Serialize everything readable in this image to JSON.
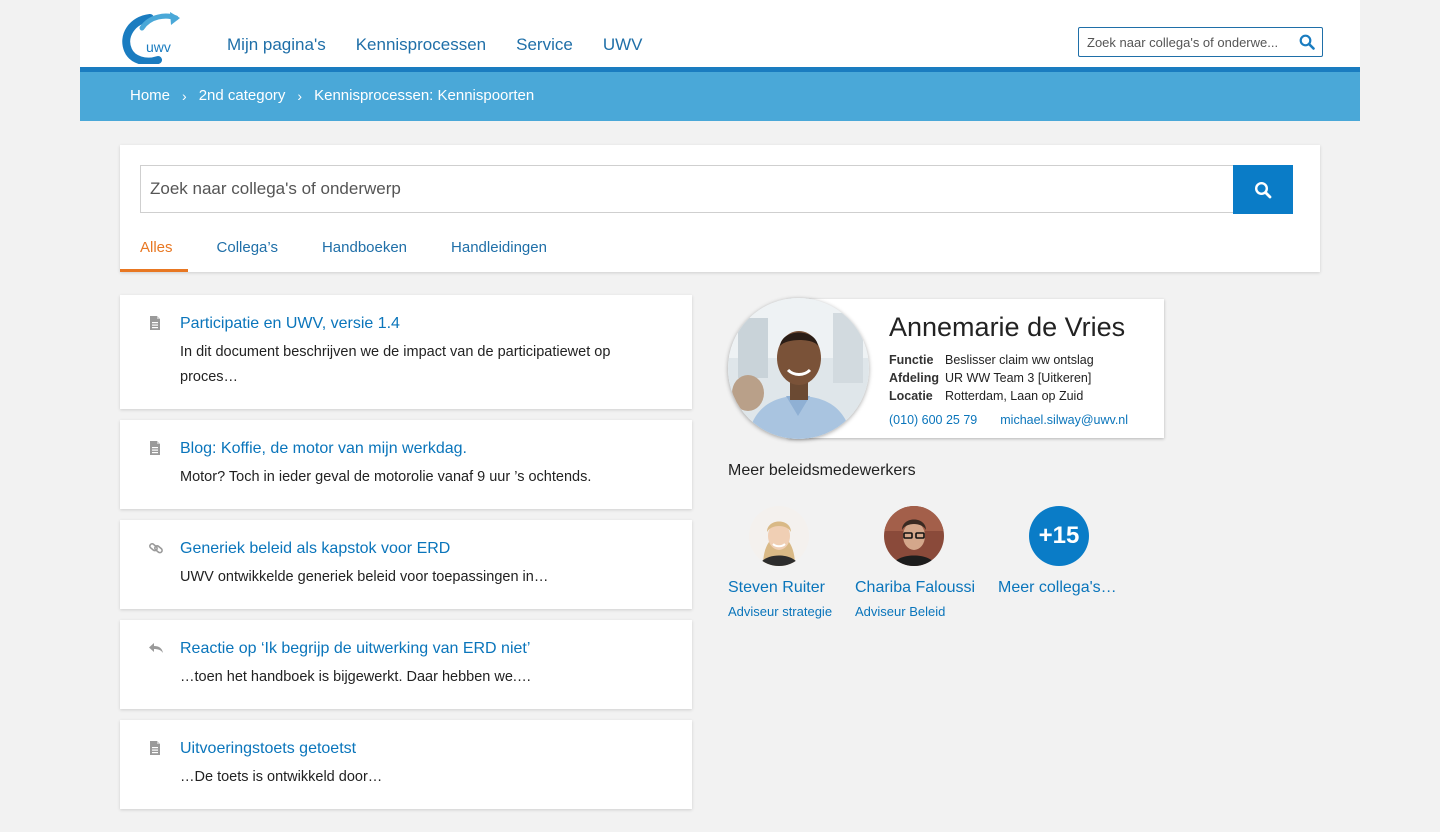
{
  "header": {
    "logo_text": "uwv",
    "nav": [
      "Mijn pagina's",
      "Kennisprocessen",
      "Service",
      "UWV"
    ],
    "search_placeholder": "Zoek naar collega's of onderwe..."
  },
  "breadcrumb": [
    "Home",
    "2nd category",
    "Kennisprocessen: Kennispoorten"
  ],
  "breadcrumb_separator": "›",
  "search": {
    "placeholder": "Zoek naar collega's of onderwerp",
    "tabs": [
      {
        "label": "Alles",
        "active": true
      },
      {
        "label": "Collega’s",
        "active": false
      },
      {
        "label": "Handboeken",
        "active": false
      },
      {
        "label": "Handleidingen",
        "active": false
      }
    ]
  },
  "results": [
    {
      "icon": "document-icon",
      "title": "Participatie en UWV, versie 1.4",
      "text": "In dit document beschrijven we de impact van de participatiewet op proces…"
    },
    {
      "icon": "document-icon",
      "title": "Blog: Koffie, de motor van mijn werkdag.",
      "text": "Motor? Toch in ieder geval de motorolie vanaf 9 uur ’s ochtends."
    },
    {
      "icon": "link-icon",
      "title": "Generiek beleid als kapstok voor ERD",
      "text": "UWV ontwikkelde generiek beleid voor toepassingen in…"
    },
    {
      "icon": "reply-icon",
      "title": "Reactie op ‘Ik begrijp de uitwerking van ERD niet’",
      "text": "…toen het handboek is bijgewerkt. Daar hebben we.…"
    },
    {
      "icon": "document-icon",
      "title": "Uitvoeringstoets getoetst",
      "text": "…De toets is ontwikkeld door…"
    }
  ],
  "profile": {
    "name": "Annemarie de Vries",
    "fields": [
      {
        "label": "Functie",
        "value": "Beslisser claim ww ontslag"
      },
      {
        "label": "Afdeling",
        "value": "UR WW Team 3 [Uitkeren]"
      },
      {
        "label": "Locatie",
        "value": "Rotterdam, Laan op Zuid"
      }
    ],
    "phone": "(010) 600 25 79",
    "email": "michael.silway@uwv.nl"
  },
  "colleagues": {
    "heading": "Meer beleidsmedewerkers",
    "people": [
      {
        "name": "Steven Ruiter",
        "role": "Adviseur strategie"
      },
      {
        "name": "Chariba Faloussi",
        "role": "Adviseur Beleid"
      }
    ],
    "more_count": "+15",
    "more_label": "Meer collega's…"
  },
  "colors": {
    "brand_blue": "#0a7cc7",
    "bar_blue": "#4aa8d8",
    "accent_orange": "#e87722",
    "link_blue": "#0a75bb"
  }
}
